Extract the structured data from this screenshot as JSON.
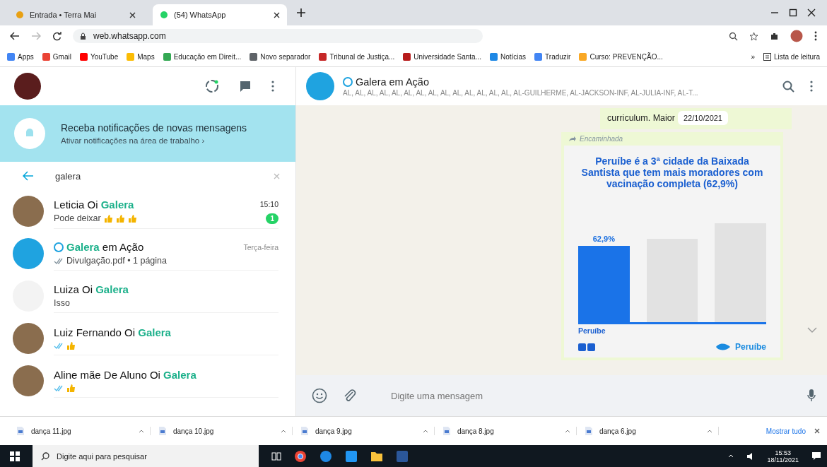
{
  "browser": {
    "tabs": [
      {
        "title": "Entrada • Terra Mai",
        "selected": false
      },
      {
        "title": "(54) WhatsApp",
        "selected": true
      }
    ],
    "url": "web.whatsapp.com",
    "bookmarks": [
      {
        "label": "Apps",
        "color": "#4285f4"
      },
      {
        "label": "Gmail",
        "color": "#ea4335"
      },
      {
        "label": "YouTube",
        "color": "#ff0000"
      },
      {
        "label": "Maps",
        "color": "#fbbc04"
      },
      {
        "label": "Educação em Direit...",
        "color": "#34a853"
      },
      {
        "label": "Novo separador",
        "color": "#5f6368"
      },
      {
        "label": "Tribunal de Justiça...",
        "color": "#c62828"
      },
      {
        "label": "Universidade Santa...",
        "color": "#b71c1c"
      },
      {
        "label": "Notícias",
        "color": "#1e88e5"
      },
      {
        "label": "Traduzir",
        "color": "#4285f4"
      },
      {
        "label": "Curso: PREVENÇÃO...",
        "color": "#f9a825"
      }
    ],
    "more": "»",
    "reading_list": "Lista de leitura"
  },
  "sidebar": {
    "banner": {
      "title": "Receba notificações de novas mensagens",
      "link": "Ativar notificações na área de trabalho ›"
    },
    "search": {
      "value": "galera"
    },
    "chats": [
      {
        "kind": "contact",
        "prefix": "Leticia Oi ",
        "match": "Galera",
        "time": "15:10",
        "preview": "Pode deixar",
        "emojis": [
          {
            "kind": "thumbs_up"
          },
          {
            "kind": "thumbs_up"
          },
          {
            "kind": "thumbs_up"
          }
        ],
        "unread": "1"
      },
      {
        "kind": "group",
        "match": "Galera",
        "suffix": " em Ação",
        "time": "Terça-feira",
        "preview": "Divulgação.pdf • 1 página",
        "read": false
      },
      {
        "kind": "no_photo",
        "prefix": "Luiza Oi ",
        "match": "Galera",
        "preview": "Isso"
      },
      {
        "kind": "contact",
        "prefix": "Luiz Fernando Oi ",
        "match": "Galera",
        "read": true,
        "emojis": [
          {
            "kind": "thumbs_up"
          }
        ]
      },
      {
        "kind": "contact",
        "prefix": "Aline mãe De Aluno Oi ",
        "match": "Galera",
        "read": true,
        "emojis": [
          {
            "kind": "thumbs_up"
          }
        ]
      }
    ]
  },
  "conversation": {
    "title": "Galera em Ação",
    "members": "AL, AL, AL, AL, AL, AL, AL, AL, AL, AL, AL, AL, AL, AL, AL-GUILHERME, AL-JACKSON-INF, AL-JULIA-INF, AL-T...",
    "message_text": "curriculum. Maior",
    "date_pill": "22/10/2021",
    "forwarded": "Encaminhada",
    "image": {
      "title": "Peruíbe é a 3ª cidade da Baixada Santista que tem mais moradores com vacinação completa (62,9%)",
      "bar_label": "62,9%",
      "category": "Peruíbe",
      "logo": "Peruíbe"
    },
    "composer_placeholder": "Digite uma mensagem"
  },
  "downloads": {
    "files": [
      "dança 11.jpg",
      "dança 10.jpg",
      "dança 9.jpg",
      "dança 8.jpg",
      "dança 6.jpg"
    ],
    "show_all": "Mostrar tudo"
  },
  "taskbar": {
    "search_placeholder": "Digite aqui para pesquisar",
    "time": "15:53",
    "date": "18/11/2021"
  }
}
